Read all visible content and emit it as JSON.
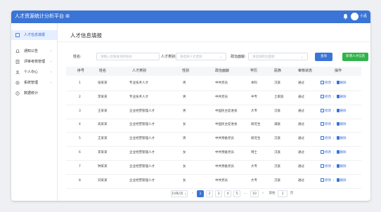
{
  "app": {
    "title": "人才资源统计分析平台",
    "title_suffix": "⊞",
    "user": "小孟"
  },
  "sidebar": {
    "items": [
      {
        "label": "人才信息填报",
        "icon": "clipboard-icon",
        "active": true
      },
      {
        "label": "通知公告",
        "icon": "bell-icon",
        "chevron": "›"
      },
      {
        "label": "评审考核管理",
        "icon": "document-icon",
        "chevron": "›"
      },
      {
        "label": "个人中心",
        "icon": "user-icon",
        "chevron": "›"
      },
      {
        "label": "系统管理",
        "icon": "gear-icon",
        "chevron": "›"
      },
      {
        "label": "数据统计",
        "icon": "clock-icon"
      }
    ]
  },
  "page": {
    "title": "人才信息填报"
  },
  "filters": {
    "name_label": "姓名:",
    "name_placeholder": "请输入您要查询的姓名",
    "category_label": "人才类别:",
    "category_placeholder": "请选择人才类别",
    "politics_label": "政治面貌:",
    "politics_placeholder": "请选择政治面貌",
    "arrow": "⌄",
    "search_label": "查询",
    "add_label": "新增人才信息"
  },
  "table": {
    "headers": [
      "序号",
      "姓名",
      "人才类别",
      "性别",
      "政治面貌",
      "学历",
      "民族",
      "审核状态",
      "操作"
    ],
    "rows": [
      [
        "1",
        "张某某",
        "专业技术人才",
        "男",
        "中共党员",
        "本科",
        "汉族",
        "通过"
      ],
      [
        "2",
        "李某某",
        "专业技术人才",
        "男",
        "中共党员",
        "中专",
        "土家族",
        "通过"
      ],
      [
        "3",
        "王某某",
        "企业经营管理人才",
        "男",
        "中国民主促进会",
        "大专",
        "汉族",
        "通过"
      ],
      [
        "4",
        "高某某",
        "企业经营管理人才",
        "女",
        "中国民主促进会",
        "研究生",
        "满族",
        "通过"
      ],
      [
        "5",
        "王某某",
        "企业经营管理人才",
        "男",
        "中共预备党员",
        "研究生",
        "汉族",
        "通过"
      ],
      [
        "6",
        "李某某",
        "企业经营管理人才",
        "女",
        "中共预备党员",
        "博士",
        "汉族",
        "通过"
      ],
      [
        "7",
        "钟某某",
        "企业经营管理人才",
        "女",
        "中共预备党员",
        "大专",
        "汉族",
        "通过"
      ],
      [
        "8",
        "刘某某",
        "企业经营管理人才",
        "女",
        "中共党员",
        "大专",
        "汉族",
        "通过"
      ]
    ],
    "edit_label": "修改",
    "delete_label": "删除",
    "separator": "|"
  },
  "pagination": {
    "page_size": "10条/页 ⌄",
    "prev": "‹",
    "pages": [
      "1",
      "2",
      "3",
      "4",
      "5",
      "...",
      "10"
    ],
    "current": "1",
    "next": "›",
    "goto_label": "前往",
    "goto_value": "1",
    "page_suffix": "页"
  },
  "colors": {
    "primary": "#3a74d6",
    "success": "#31b34a"
  }
}
